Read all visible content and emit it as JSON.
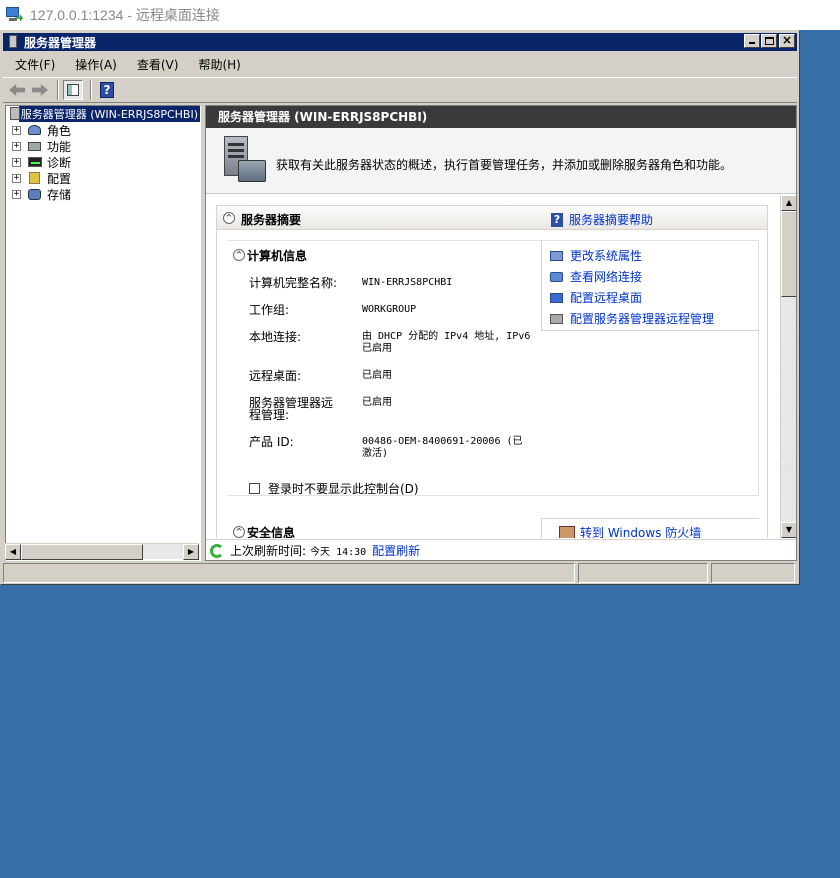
{
  "rdp": {
    "title": "127.0.0.1:1234 - 远程桌面连接"
  },
  "window": {
    "title": "服务器管理器"
  },
  "menu": [
    "文件(F)",
    "操作(A)",
    "查看(V)",
    "帮助(H)"
  ],
  "tree": {
    "root": "服务器管理器 (WIN-ERRJS8PCHBI)",
    "children": [
      "角色",
      "功能",
      "诊断",
      "配置",
      "存储"
    ]
  },
  "main": {
    "header": "服务器管理器 (WIN-ERRJS8PCHBI)",
    "banner_text": "获取有关此服务器状态的概述，执行首要管理任务，并添加或删除服务器角色和功能。",
    "summary": {
      "title": "服务器摘要",
      "help_link": "服务器摘要帮助",
      "computer_info": {
        "title": "计算机信息",
        "rows": [
          {
            "k": "计算机完整名称:",
            "v": "WIN-ERRJS8PCHBI"
          },
          {
            "k": "工作组:",
            "v": "WORKGROUP"
          },
          {
            "k": "本地连接:",
            "v": "由 DHCP 分配的 IPv4 地址, IPv6 已启用"
          },
          {
            "k": "远程桌面:",
            "v": "已启用"
          },
          {
            "k": "服务器管理器远程管理:",
            "v": "已启用"
          },
          {
            "k": "产品 ID:",
            "v": "00486-OEM-8400691-20006 (已激活)"
          }
        ],
        "links": [
          "更改系统属性",
          "查看网络连接",
          "配置远程桌面",
          "配置服务器管理器远程管理"
        ],
        "checkbox_label": "登录时不要显示此控制台(D)"
      },
      "security_info": {
        "title": "安全信息",
        "link": "转到 Windows 防火墙"
      }
    },
    "refresh": {
      "label": "上次刷新时间:",
      "time": "今天 14:30",
      "link": "配置刷新"
    }
  }
}
